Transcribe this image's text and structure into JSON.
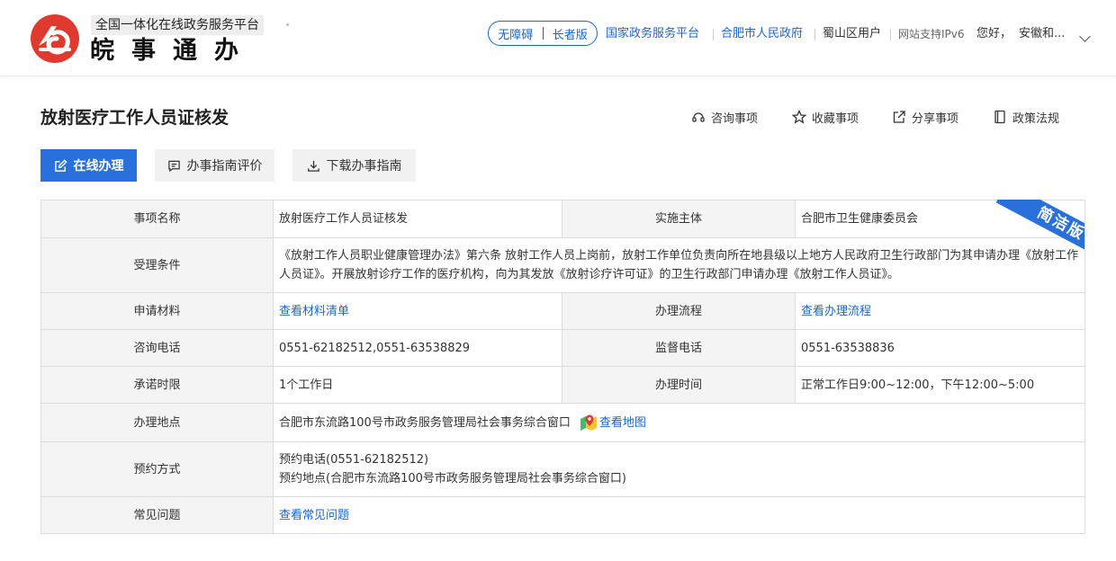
{
  "header": {
    "logo_subtitle": "全国一体化在线政务服务平台",
    "logo_title": "皖事通办",
    "accessibility_label": "无障碍",
    "elder_label": "长者版",
    "nav_national": "国家政务服务平台",
    "nav_city": "合肥市人民政府",
    "nav_district": "蜀山区用户",
    "ipv6": "网站支持IPv6",
    "greeting": "您好，",
    "username": "安徽和..."
  },
  "page": {
    "title": "放射医疗工作人员证核发",
    "actions": [
      "咨询事项",
      "收藏事项",
      "分享事项",
      "政策法规"
    ],
    "buttons": {
      "online": "在线办理",
      "evaluate": "办事指南评价",
      "download": "下载办事指南"
    },
    "ribbon": "简洁版"
  },
  "table": {
    "item_name_label": "事项名称",
    "item_name": "放射医疗工作人员证核发",
    "subject_label": "实施主体",
    "subject": "合肥市卫生健康委员会",
    "conditions_label": "受理条件",
    "conditions": "《放射工作人员职业健康管理办法》第六条 放射工作人员上岗前，放射工作单位负责向所在地县级以上地方人民政府卫生行政部门为其申请办理《放射工作人员证》。开展放射诊疗工作的医疗机构，向为其发放《放射诊疗许可证》的卫生行政部门申请办理《放射工作人员证》。",
    "materials_label": "申请材料",
    "materials_link": "查看材料清单",
    "process_label": "办理流程",
    "process_link": "查看办理流程",
    "consult_phone_label": "咨询电话",
    "consult_phone": "0551-62182512,0551-63538829",
    "supervise_phone_label": "监督电话",
    "supervise_phone": "0551-63538836",
    "promise_label": "承诺时限",
    "promise": "1个工作日",
    "hours_label": "办理时间",
    "hours": "正常工作日9:00~12:00，下午12:00~5:00",
    "location_label": "办理地点",
    "location": "合肥市东流路100号市政务服务管理局社会事务综合窗口",
    "map_link": "查看地图",
    "appointment_label": "预约方式",
    "appointment_phone": "预约电话(0551-62182512)",
    "appointment_place": "预约地点(合肥市东流路100号市政务服务管理局社会事务综合窗口)",
    "faq_label": "常见问题",
    "faq_link": "查看常见问题"
  },
  "colors": {
    "accent": "#2a70dc",
    "link": "#1a66ce",
    "logo": "#e03a2f"
  }
}
